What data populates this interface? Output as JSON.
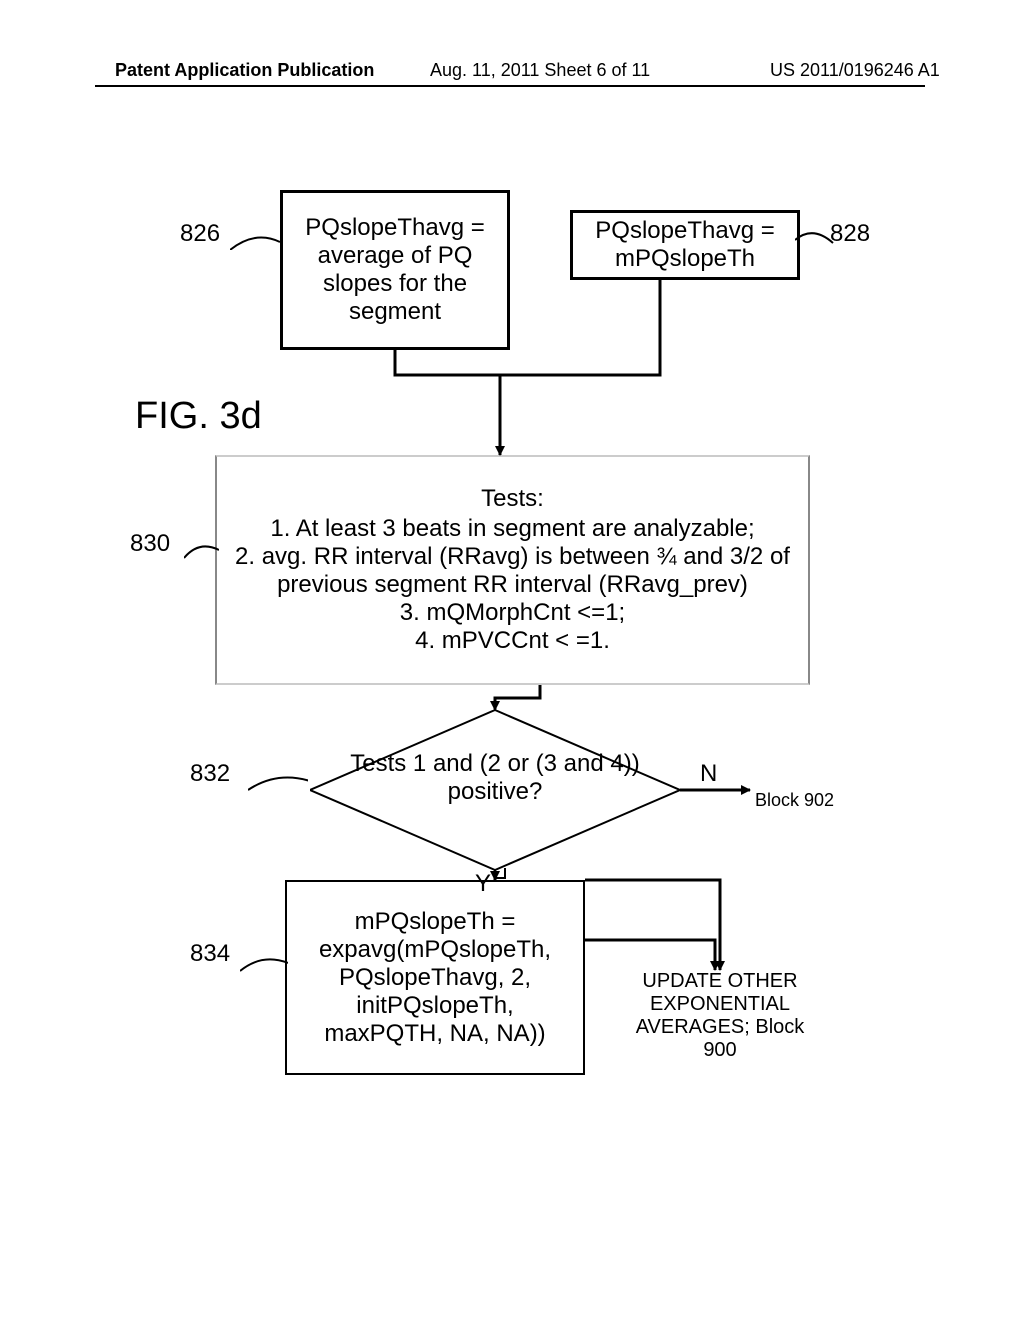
{
  "header": {
    "left": "Patent Application Publication",
    "center": "Aug. 11, 2011  Sheet 6 of 11",
    "right": "US 2011/0196246 A1"
  },
  "figure_title": "FIG. 3d",
  "boxes": {
    "b826": {
      "ref": "826",
      "text": "PQslopeThavg = average of PQ slopes for the segment"
    },
    "b828": {
      "ref": "828",
      "text": "PQslopeThavg = mPQslopeTh"
    },
    "b830": {
      "ref": "830",
      "heading": "Tests:",
      "line1": "1. At least 3 beats in segment are analyzable;",
      "line2": "2. avg. RR interval (RRavg) is between ¾ and 3/2 of previous segment RR interval (RRavg_prev)",
      "line3": "3. mQMorphCnt <=1;",
      "line4": "4. mPVCCnt < =1."
    },
    "b834": {
      "ref": "834",
      "text": "mPQslopeTh = expavg(mPQslopeTh, PQslopeThavg, 2, initPQslopeTh, maxPQTH, NA, NA))"
    }
  },
  "decision": {
    "ref": "832",
    "text": "Tests 1 and (2 or (3 and 4)) positive?",
    "yes": "Y",
    "no": "N"
  },
  "outputs": {
    "block902": "Block 902",
    "block900": "UPDATE OTHER EXPONENTIAL AVERAGES; Block 900"
  },
  "chart_data": {
    "type": "flowchart",
    "nodes": [
      {
        "id": "826",
        "type": "process",
        "label": "PQslopeThavg = average of PQ slopes for the segment"
      },
      {
        "id": "828",
        "type": "process",
        "label": "PQslopeThavg = mPQslopeTh"
      },
      {
        "id": "830",
        "type": "process",
        "label": "Tests: 1. At least 3 beats in segment are analyzable; 2. avg. RR interval (RRavg) is between ¾ and 3/2 of previous segment RR interval (RRavg_prev); 3. mQMorphCnt <=1; 4. mPVCCnt < =1."
      },
      {
        "id": "832",
        "type": "decision",
        "label": "Tests 1 and (2 or (3 and 4)) positive?"
      },
      {
        "id": "834",
        "type": "process",
        "label": "mPQslopeTh = expavg(mPQslopeTh, PQslopeThavg, 2, initPQslopeTh, maxPQTH, NA, NA))"
      },
      {
        "id": "900",
        "type": "terminal",
        "label": "UPDATE OTHER EXPONENTIAL AVERAGES; Block 900"
      },
      {
        "id": "902",
        "type": "terminal",
        "label": "Block 902"
      }
    ],
    "edges": [
      {
        "from": "826",
        "to": "830"
      },
      {
        "from": "828",
        "to": "830"
      },
      {
        "from": "830",
        "to": "832"
      },
      {
        "from": "832",
        "to": "834",
        "label": "Y"
      },
      {
        "from": "832",
        "to": "902",
        "label": "N"
      },
      {
        "from": "834",
        "to": "900"
      }
    ]
  }
}
